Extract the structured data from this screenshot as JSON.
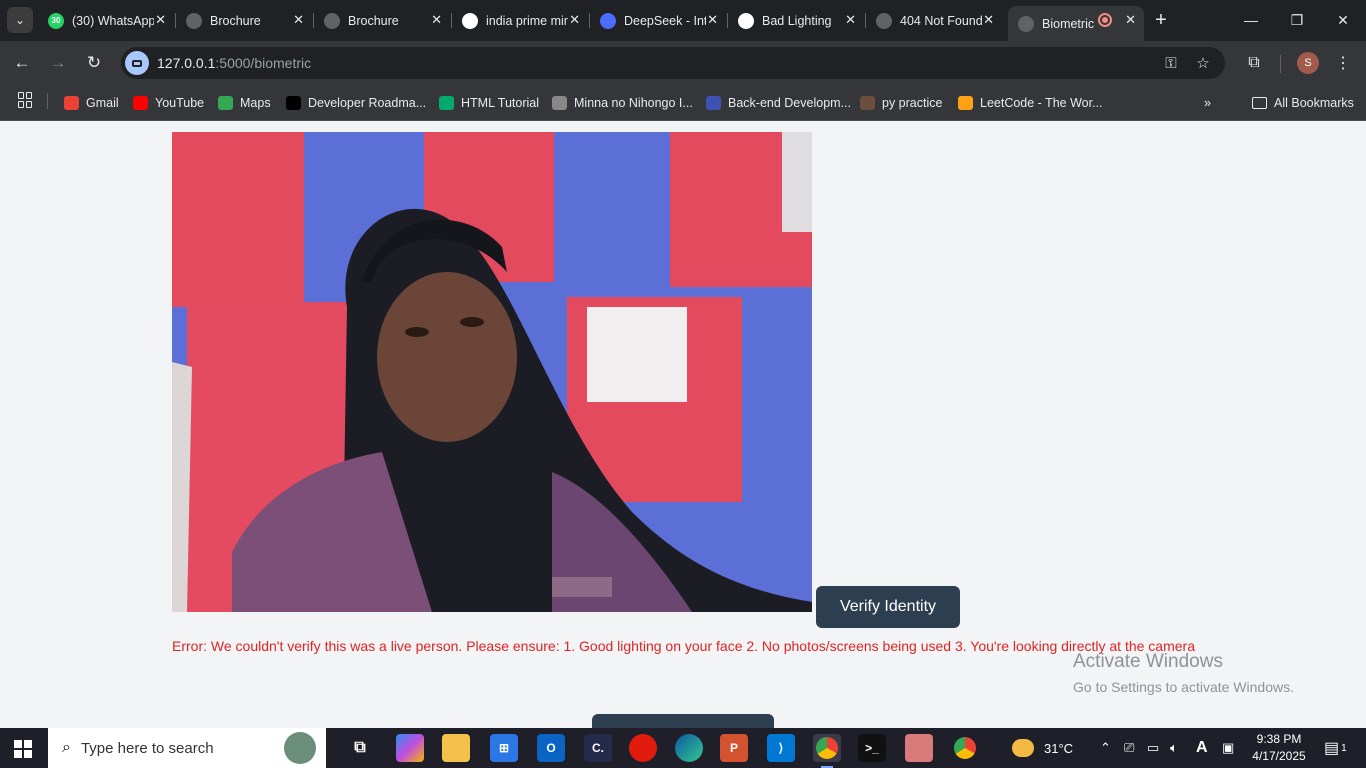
{
  "tabs": [
    {
      "title": "(30) WhatsApp",
      "favicon": "whatsapp-icon",
      "color": "#25d366",
      "badge": "30"
    },
    {
      "title": "Brochure",
      "favicon": "globe-icon",
      "color": "#5f6368"
    },
    {
      "title": "Brochure",
      "favicon": "globe-icon",
      "color": "#5f6368"
    },
    {
      "title": "india prime minister",
      "favicon": "google-icon",
      "color": "#ffffff"
    },
    {
      "title": "DeepSeek - Into the Unknown",
      "favicon": "deepseek-icon",
      "color": "#4d6bfe"
    },
    {
      "title": "Bad Lighting",
      "favicon": "openai-icon",
      "color": "#ffffff"
    },
    {
      "title": "404 Not Found",
      "favicon": "globe-icon",
      "color": "#5f6368"
    },
    {
      "title": "Biometric",
      "favicon": "globe-icon",
      "color": "#5f6368",
      "active": true
    }
  ],
  "address_bar": {
    "host": "127.0.0.1",
    "rest": ":5000/biometric"
  },
  "profile_initial": "S",
  "bookmarks": [
    {
      "label": "Gmail",
      "icon": "gmail-icon",
      "color": "#ea4335"
    },
    {
      "label": "YouTube",
      "icon": "youtube-icon",
      "color": "#ff0000"
    },
    {
      "label": "Maps",
      "icon": "maps-icon",
      "color": "#34a853"
    },
    {
      "label": "Developer Roadma...",
      "icon": "roadmap-icon",
      "color": "#000000"
    },
    {
      "label": "HTML Tutorial",
      "icon": "w3schools-icon",
      "color": "#04aa6d"
    },
    {
      "label": "Minna no Nihongo I...",
      "icon": "book-icon",
      "color": "#888888"
    },
    {
      "label": "Back-end Developm...",
      "icon": "course-icon",
      "color": "#3f51b5"
    },
    {
      "label": "py practice",
      "icon": "cc-icon",
      "color": "#6b4e3d"
    },
    {
      "label": "LeetCode - The Wor...",
      "icon": "leetcode-icon",
      "color": "#ffa116"
    }
  ],
  "all_bookmarks_label": "All Bookmarks",
  "page": {
    "verify_button": "Verify Identity",
    "error": "Error: We couldn't verify this was a live person. Please ensure: 1. Good lighting on your face 2. No photos/screens being used 3. You're looking directly at the camera"
  },
  "watermark": {
    "title": "Activate Windows",
    "subtitle": "Go to Settings to activate Windows."
  },
  "taskbar": {
    "search_placeholder": "Type here to search",
    "weather": "31°C",
    "time": "9:38 PM",
    "date": "4/17/2025",
    "notification_count": "1"
  }
}
